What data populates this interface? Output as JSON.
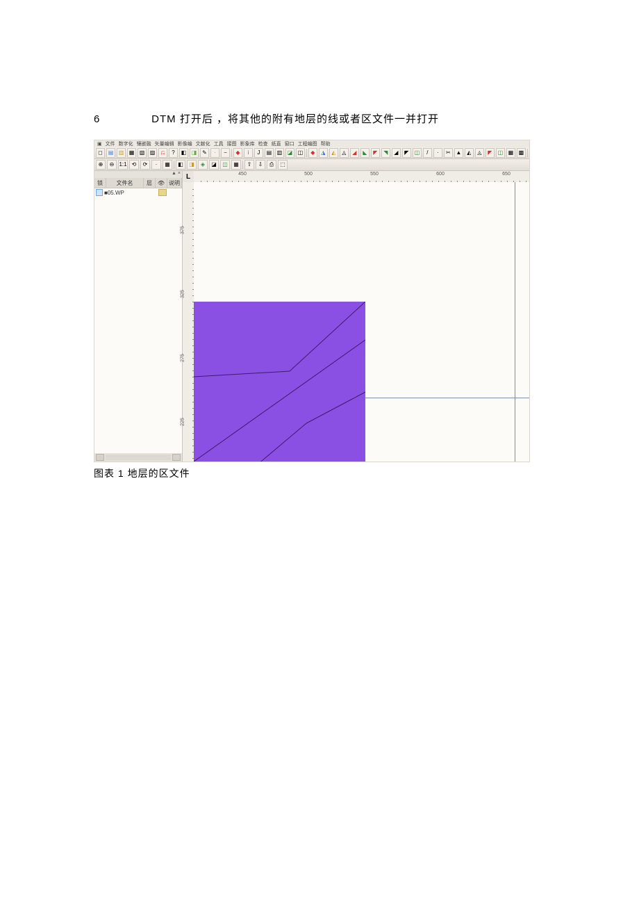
{
  "step": {
    "number": "6",
    "text": "DTM 打开后 ，将其他的附有地层的线或者区文件一并打开"
  },
  "caption": "图表 1 地层的区文件",
  "menubar": [
    "文件",
    "数字化",
    "镶嵌融",
    "矢量编辑",
    "影像编",
    "文献化",
    "工具",
    "接图",
    "影象库",
    "检查",
    "纸直",
    "窗口",
    "工程编图",
    "帮助"
  ],
  "panel": {
    "headers": {
      "lock": "锁",
      "name": "文件名",
      "ov": "层",
      "vi": "👁",
      "desc": "说明"
    },
    "topButtons": [
      "▲",
      "×"
    ],
    "file": "■05.WP"
  },
  "ruler": {
    "corner": "L",
    "h": [
      "450",
      "500",
      "550",
      "600",
      "650"
    ],
    "v": [
      "375",
      "325",
      "275",
      "225"
    ]
  },
  "toolbar1_count": 38,
  "toolbar2_count": 18,
  "toolbar1_glyphs": [
    "◻",
    "▤",
    "▥",
    "▦",
    "▧",
    "▨",
    "⎌",
    "?",
    "◧",
    "◨",
    "✎",
    "·",
    "⎯",
    "",
    "◆",
    "i",
    "J",
    "▤",
    "▥",
    "◪",
    "◫",
    "",
    "◆",
    "◮",
    "◭",
    "◬",
    "◢",
    "◣",
    "◤",
    "◥",
    "◢",
    "◤",
    "◫",
    "/",
    "·",
    "✂",
    "▲",
    "◭",
    "◬",
    "◤",
    "◫",
    "▦",
    "▩",
    ""
  ],
  "toolbar2_glyphs": [
    "⊕",
    "⊖",
    "1:1",
    "⟲",
    "⟳",
    "·",
    "▦",
    "",
    "◧",
    "◨",
    "◈",
    "◪",
    "◫",
    "▦",
    "",
    "⇧",
    "⇩",
    "⎙",
    "⬚"
  ]
}
